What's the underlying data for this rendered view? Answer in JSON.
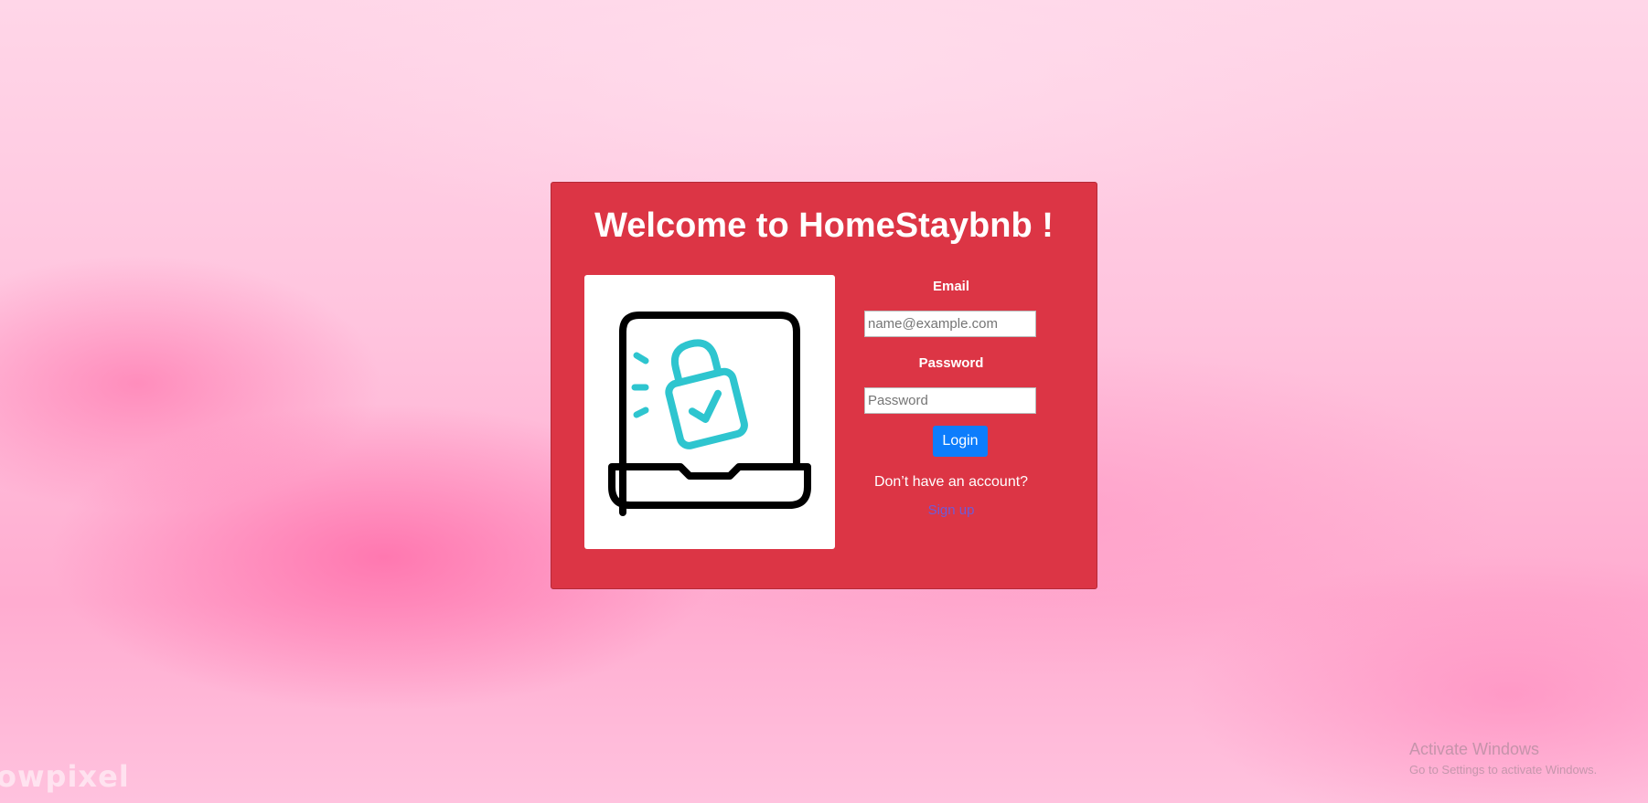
{
  "page": {
    "title": "Welcome to HomeStaybnb !"
  },
  "illustration": {
    "icon": "laptop-lock-icon",
    "colors": {
      "outline": "#000000",
      "accent": "#2ec5cf"
    }
  },
  "form": {
    "email_label": "Email",
    "email_placeholder": "name@example.com",
    "password_label": "Password",
    "password_placeholder": "Password",
    "login_label": "Login",
    "no_account_text": "Don’t have an account?",
    "signup_label": "Sign up"
  },
  "colors": {
    "card_background": "#dc3545",
    "login_button": "#0d7dfc",
    "signup_link": "#6f5bd6"
  },
  "overlay": {
    "watermark": "owpixel",
    "activate_title": "Activate Windows",
    "activate_subtitle": "Go to Settings to activate Windows."
  }
}
